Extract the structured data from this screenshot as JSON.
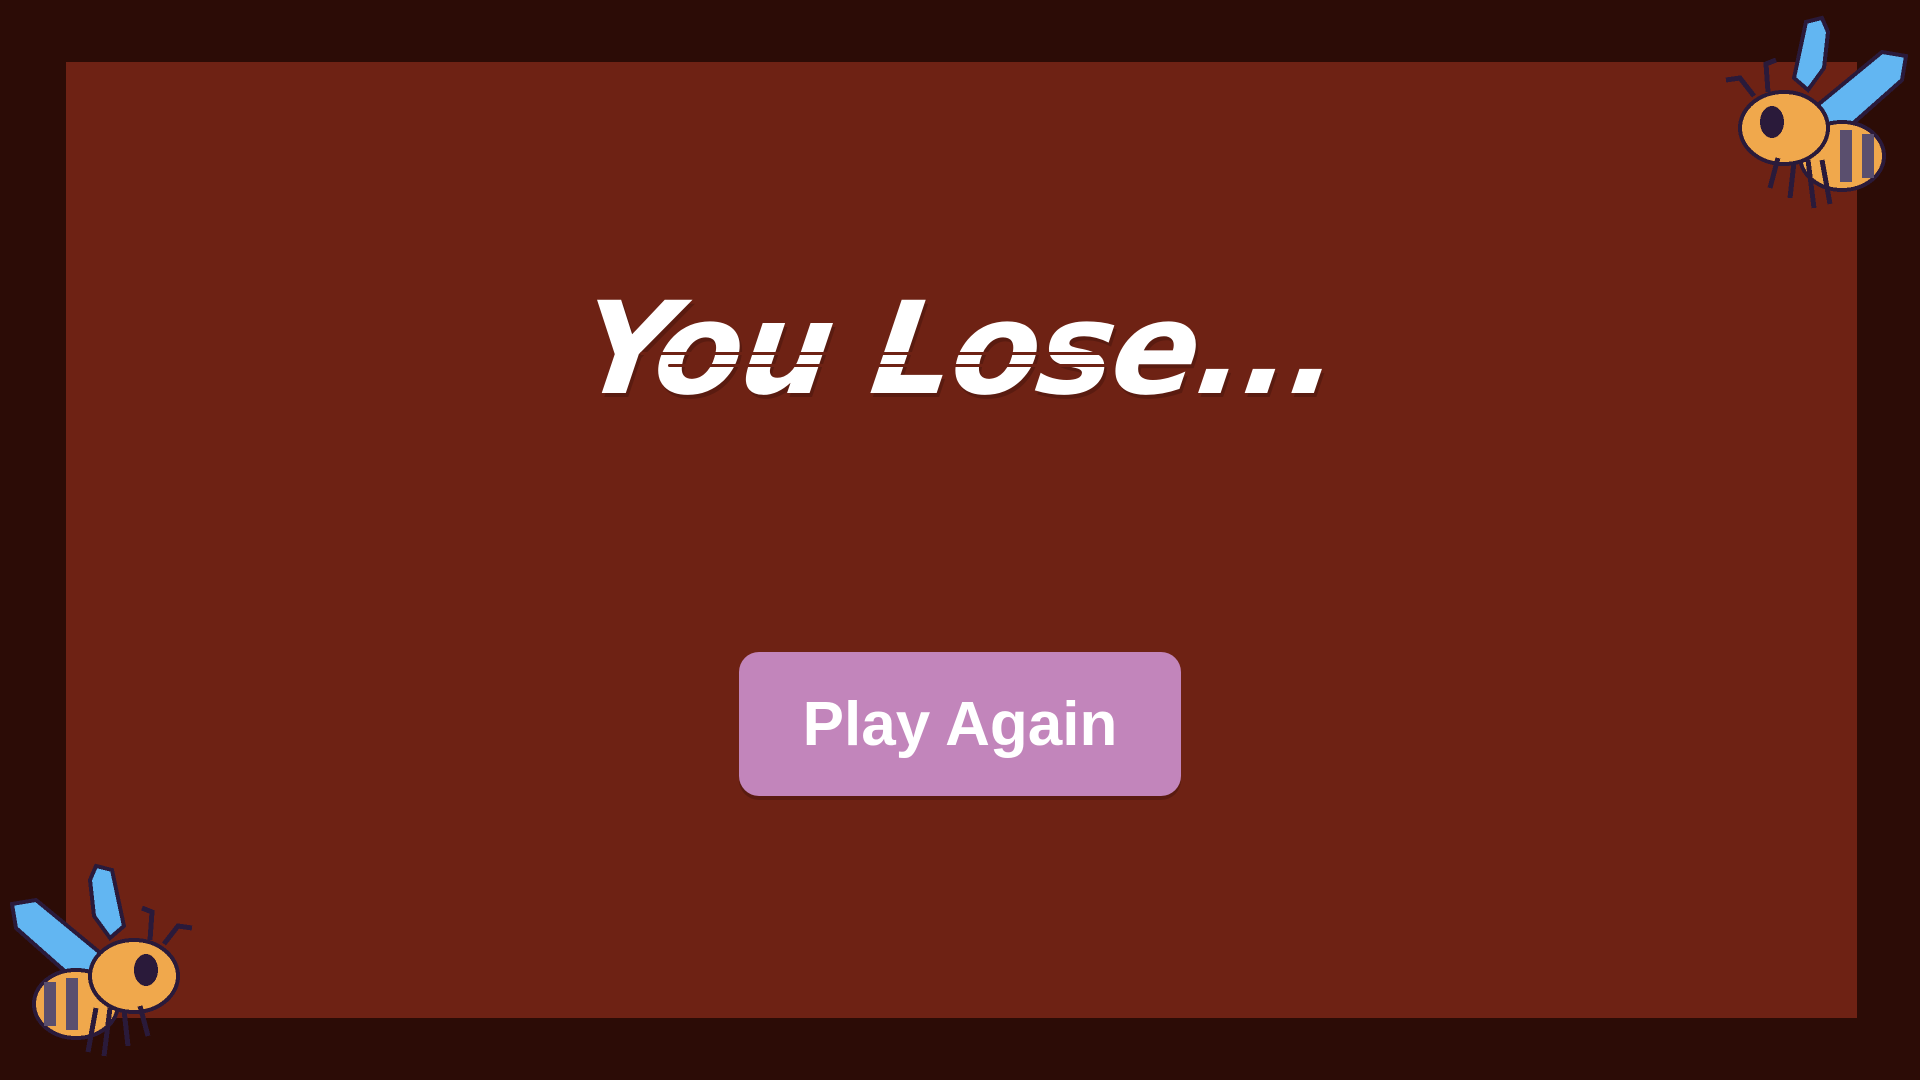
{
  "screen": {
    "title": "You Lose...",
    "button_label": "Play Again"
  },
  "colors": {
    "outer_background": "#2c0c06",
    "panel_background": "#6e2214",
    "title_text": "#ffffff",
    "slash_line": "#6e2214",
    "button_background": "#c285bb",
    "button_text": "#ffffff",
    "bee_body": "#f0a84c",
    "bee_stripe": "#5a4f6e",
    "bee_wing": "#62b6f2",
    "bee_outline": "#2a1a3a"
  },
  "icons": {
    "top_right": "bee-icon",
    "bottom_left": "bee-icon"
  }
}
